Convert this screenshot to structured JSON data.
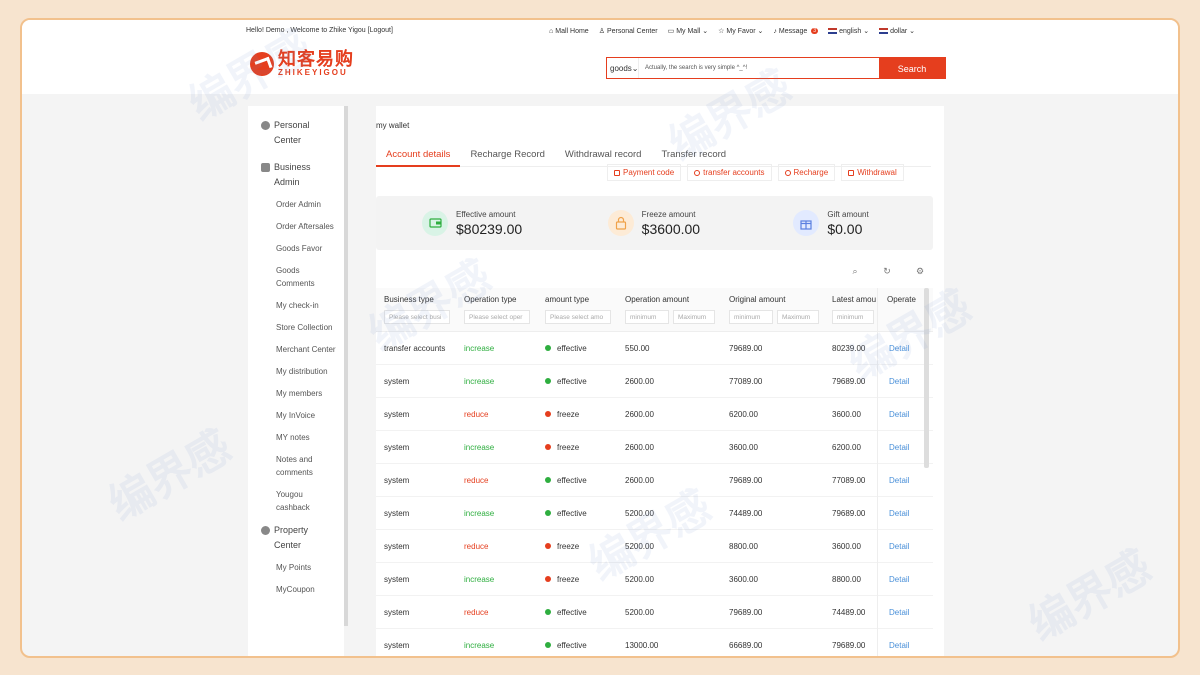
{
  "topbar": {
    "greeting": "Hello! Demo , Welcome to Zhike Yigou [Logout]",
    "nav": [
      {
        "icon": "home-icon",
        "label": "Mall Home"
      },
      {
        "icon": "user-icon",
        "label": "Personal Center"
      },
      {
        "icon": "shop-icon",
        "label": "My Mall ⌄"
      },
      {
        "icon": "star-icon",
        "label": "My Favor ⌄"
      },
      {
        "icon": "bell-icon",
        "label": "Message"
      },
      {
        "icon": "flag-uk-icon",
        "label": "english ⌄"
      },
      {
        "icon": "flag-uk-icon",
        "label": "dollar ⌄"
      }
    ],
    "message_count": "3"
  },
  "logo": {
    "cn": "知客易购",
    "en": "ZHIKEYIGOU"
  },
  "search": {
    "select": "goods⌄",
    "placeholder": "Actually, the search is very simple ^_^!",
    "button": "Search"
  },
  "sidebar": {
    "personal": "Personal Center",
    "business": "Business Admin",
    "items": [
      "Order Admin",
      "Order Aftersales",
      "Goods Favor",
      "Goods Comments",
      "My check-in",
      "Store Collection",
      "Merchant Center",
      "My distribution",
      "My members",
      "My InVoice",
      "MY notes",
      "Notes and comments",
      "Yougou cashback"
    ],
    "property": "Property Center",
    "property_items": [
      "My Points",
      "MyCoupon"
    ]
  },
  "main": {
    "title": "my wallet",
    "tabs": [
      "Account details",
      "Recharge Record",
      "Withdrawal record",
      "Transfer record"
    ],
    "actions": [
      "Payment code",
      "transfer accounts",
      "Recharge",
      "Withdrawal"
    ],
    "cards": [
      {
        "label": "Effective amount",
        "value": "$80239.00",
        "icon": "wallet-icon",
        "color": "#d9f3e6"
      },
      {
        "label": "Freeze amount",
        "value": "$3600.00",
        "icon": "lock-icon",
        "color": "#fdebd6"
      },
      {
        "label": "Gift amount",
        "value": "$0.00",
        "icon": "gift-icon",
        "color": "#e2eaff"
      }
    ]
  },
  "table": {
    "headers": [
      "Business type",
      "Operation type",
      "amount type",
      "Operation amount",
      "Original amount",
      "Latest amou",
      "Operate"
    ],
    "filters": [
      "Please select busi",
      "Please select oper",
      "Please select amo",
      "minimum",
      "Maximum",
      "minimum",
      "Maximum",
      "minimum"
    ],
    "rows": [
      {
        "business": "transfer accounts",
        "op": "increase",
        "type": "effective",
        "amount": "550.00",
        "original": "79689.00",
        "latest": "80239.00",
        "action": "Detail"
      },
      {
        "business": "system",
        "op": "increase",
        "type": "effective",
        "amount": "2600.00",
        "original": "77089.00",
        "latest": "79689.00",
        "action": "Detail"
      },
      {
        "business": "system",
        "op": "reduce",
        "type": "freeze",
        "amount": "2600.00",
        "original": "6200.00",
        "latest": "3600.00",
        "action": "Detail"
      },
      {
        "business": "system",
        "op": "increase",
        "type": "freeze",
        "amount": "2600.00",
        "original": "3600.00",
        "latest": "6200.00",
        "action": "Detail"
      },
      {
        "business": "system",
        "op": "reduce",
        "type": "effective",
        "amount": "2600.00",
        "original": "79689.00",
        "latest": "77089.00",
        "action": "Detail"
      },
      {
        "business": "system",
        "op": "increase",
        "type": "effective",
        "amount": "5200.00",
        "original": "74489.00",
        "latest": "79689.00",
        "action": "Detail"
      },
      {
        "business": "system",
        "op": "reduce",
        "type": "freeze",
        "amount": "5200.00",
        "original": "8800.00",
        "latest": "3600.00",
        "action": "Detail"
      },
      {
        "business": "system",
        "op": "increase",
        "type": "freeze",
        "amount": "5200.00",
        "original": "3600.00",
        "latest": "8800.00",
        "action": "Detail"
      },
      {
        "business": "system",
        "op": "reduce",
        "type": "effective",
        "amount": "5200.00",
        "original": "79689.00",
        "latest": "74489.00",
        "action": "Detail"
      },
      {
        "business": "system",
        "op": "increase",
        "type": "effective",
        "amount": "13000.00",
        "original": "66689.00",
        "latest": "79689.00",
        "action": "Detail"
      }
    ]
  },
  "colors": {
    "accent": "#e53e1e",
    "increase": "#2eae3f",
    "effective_dot": "#2eae3f",
    "freeze_dot": "#e53e1e",
    "link": "#4a90d9"
  },
  "watermark": "编界感"
}
